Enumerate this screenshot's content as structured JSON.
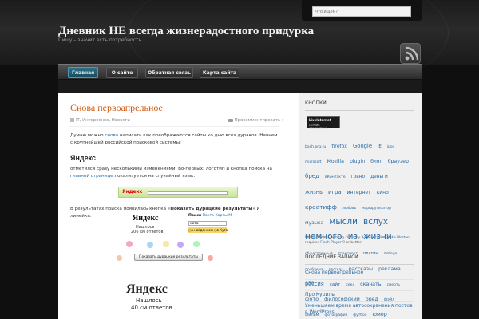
{
  "header": {
    "search_placeholder": "что ищем?",
    "site_title": "Дневник НЕ всегда жизнерадостного придурка",
    "site_tagline": "Пишу – значит есть потребность",
    "rss_icon": "rss-icon"
  },
  "nav": [
    {
      "label": "Главная",
      "active": true
    },
    {
      "label": "О сайте",
      "active": false
    },
    {
      "label": "Обратная связь",
      "active": false
    },
    {
      "label": "Карта сайта",
      "active": false
    }
  ],
  "post": {
    "title": "Снова первоапрельное",
    "categories": "IT, Интересное, Новости",
    "comments": "Прокомментировать »",
    "p1_pre": "Думаю можно ",
    "p1_link": "снова",
    "p1_post": " написать как преображаются сайты ко дню всех дураков. Начнем с крупнейшей российской поисковой системы:",
    "h2": "Яндекс",
    "p2_pre": "отметился сразу несколькими изменениями. Во-первых: логотип и кнопка поиска на ",
    "p2_link": "главной странице",
    "p2_post": " локализуется на случайный язык.",
    "p3_pre": "В результатах поиска появилась кнопка «",
    "p3_bold": "Показать дурацкие результаты",
    "p3_post": "» и линейка.",
    "shot": {
      "logo": "Яндекс",
      "found": "Нашлось",
      "count": "206 км ответов",
      "tabs": [
        "Поиск",
        "Почта",
        "Карты",
        "М"
      ],
      "query": "кота",
      "radio1": "в найденном",
      "radio2": "в Кута",
      "button": "Показать дурацкие результаты",
      "logo2": "Яндекс",
      "found2": "Нашлось",
      "count2": "40 см ответов"
    }
  },
  "sidebar": {
    "buttons_title": "КНОПКИ",
    "badge_line1": "LiveInternet",
    "badge_line2": "СЕРВИС СТАТИСТИКИ",
    "tags": [
      {
        "t": "bash.org.ru",
        "s": 4.6
      },
      {
        "t": "firefox",
        "s": 6.2
      },
      {
        "t": "Google",
        "s": 6.8
      },
      {
        "t": "IE",
        "s": 5
      },
      {
        "t": "ipod",
        "s": 4.4
      },
      {
        "t": "microsoft",
        "s": 4.4
      },
      {
        "t": "Mozilla",
        "s": 6.2
      },
      {
        "t": "plugin",
        "s": 6.2
      },
      {
        "t": "блог",
        "s": 6
      },
      {
        "t": "браузер",
        "s": 6.2
      },
      {
        "t": "бред",
        "s": 7
      },
      {
        "t": "вКонтакте",
        "s": 4.6
      },
      {
        "t": "говно",
        "s": 5.8
      },
      {
        "t": "деньги",
        "s": 5.8
      },
      {
        "t": "жизнь",
        "s": 6.6
      },
      {
        "t": "игра",
        "s": 6.8
      },
      {
        "t": "интернет",
        "s": 6
      },
      {
        "t": "кино",
        "s": 6
      },
      {
        "t": "креатифф",
        "s": 7.4
      },
      {
        "t": "любовь",
        "s": 4.4
      },
      {
        "t": "маршрутизатор",
        "s": 4.4
      },
      {
        "t": "музыка",
        "s": 6
      },
      {
        "t": "мысли",
        "s": 10.5
      },
      {
        "t": "вслух",
        "s": 10.5
      },
      {
        "t": "немного",
        "s": 10.5
      },
      {
        "t": "из",
        "s": 10.5
      },
      {
        "t": "жизни",
        "s": 10.5
      },
      {
        "t": "общественный",
        "s": 4.4
      },
      {
        "t": "транспорт",
        "s": 4.4
      },
      {
        "t": "плагин",
        "s": 5
      },
      {
        "t": "победа",
        "s": 4.4
      },
      {
        "t": "проблема",
        "s": 4.4
      },
      {
        "t": "рассказ",
        "s": 4.4
      },
      {
        "t": "рассказы",
        "s": 6.2
      },
      {
        "t": "реклама",
        "s": 6.2
      },
      {
        "t": "россия",
        "s": 6.6
      },
      {
        "t": "сайт",
        "s": 5.6
      },
      {
        "t": "секс",
        "s": 4.6
      },
      {
        "t": "скачать",
        "s": 6.4
      },
      {
        "t": "смерть",
        "s": 4.4
      },
      {
        "t": "фото",
        "s": 6.4
      },
      {
        "t": "философский",
        "s": 6.2
      },
      {
        "t": "бред",
        "s": 6.2
      },
      {
        "t": "фэйл",
        "s": 5
      },
      {
        "t": "фильм",
        "s": 5
      },
      {
        "t": "фотография",
        "s": 4.4
      },
      {
        "t": "футбол",
        "s": 4.4
      },
      {
        "t": "юмор",
        "s": 6.4
      }
    ],
    "cumulus_pre": "WP Cumulus Flash tag cloud by ",
    "cumulus_author1": "Roy Tanck",
    "cumulus_and": " and ",
    "cumulus_author2": "Luke Morton",
    "cumulus_mid": " requires ",
    "cumulus_flash": "Flash Player",
    "cumulus_post": " 9 or better.",
    "recent_title": "ПОСЛЕДНИЕ ЗАПИСИ",
    "recent": [
      "Снова первоапрельное",
      "650",
      "Про Курилы",
      "Уменьшаем время автосохранения постов в WordPress"
    ]
  },
  "colors": {
    "accent": "#d05a10",
    "link": "#2a6ba5",
    "nav_active": "#2e7289"
  }
}
